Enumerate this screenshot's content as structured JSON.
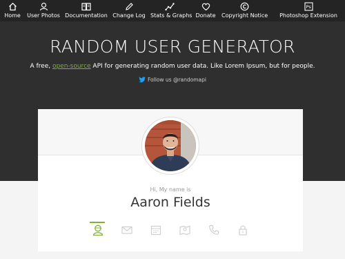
{
  "nav": {
    "items": [
      {
        "label": "Home",
        "icon": "home-icon"
      },
      {
        "label": "User Photos",
        "icon": "user-photos-icon"
      },
      {
        "label": "Documentation",
        "icon": "book-icon"
      },
      {
        "label": "Change Log",
        "icon": "pencil-icon"
      },
      {
        "label": "Stats & Graphs",
        "icon": "graph-icon"
      },
      {
        "label": "Donate",
        "icon": "heart-icon"
      },
      {
        "label": "Copyright Notice",
        "icon": "copyright-icon"
      },
      {
        "label": "Photoshop Extension",
        "icon": "photoshop-icon"
      }
    ]
  },
  "hero": {
    "title": "RANDOM USER GENERATOR",
    "tagline_before": "A free, ",
    "tagline_link": "open-source",
    "tagline_after": " API for generating random user data. Like Lorem Ipsum, but for people.",
    "follow": "Follow us @randomapi"
  },
  "card": {
    "greeting": "Hi, My name is",
    "name": "Aaron Fields",
    "icons": [
      "user-icon",
      "envelope-icon",
      "calendar-icon",
      "map-icon",
      "phone-icon",
      "lock-icon"
    ],
    "active_icon": "user-icon"
  },
  "colors": {
    "accent": "#7fb03a",
    "hero_bg": "#2f2f30",
    "nav_bg": "#242425"
  }
}
